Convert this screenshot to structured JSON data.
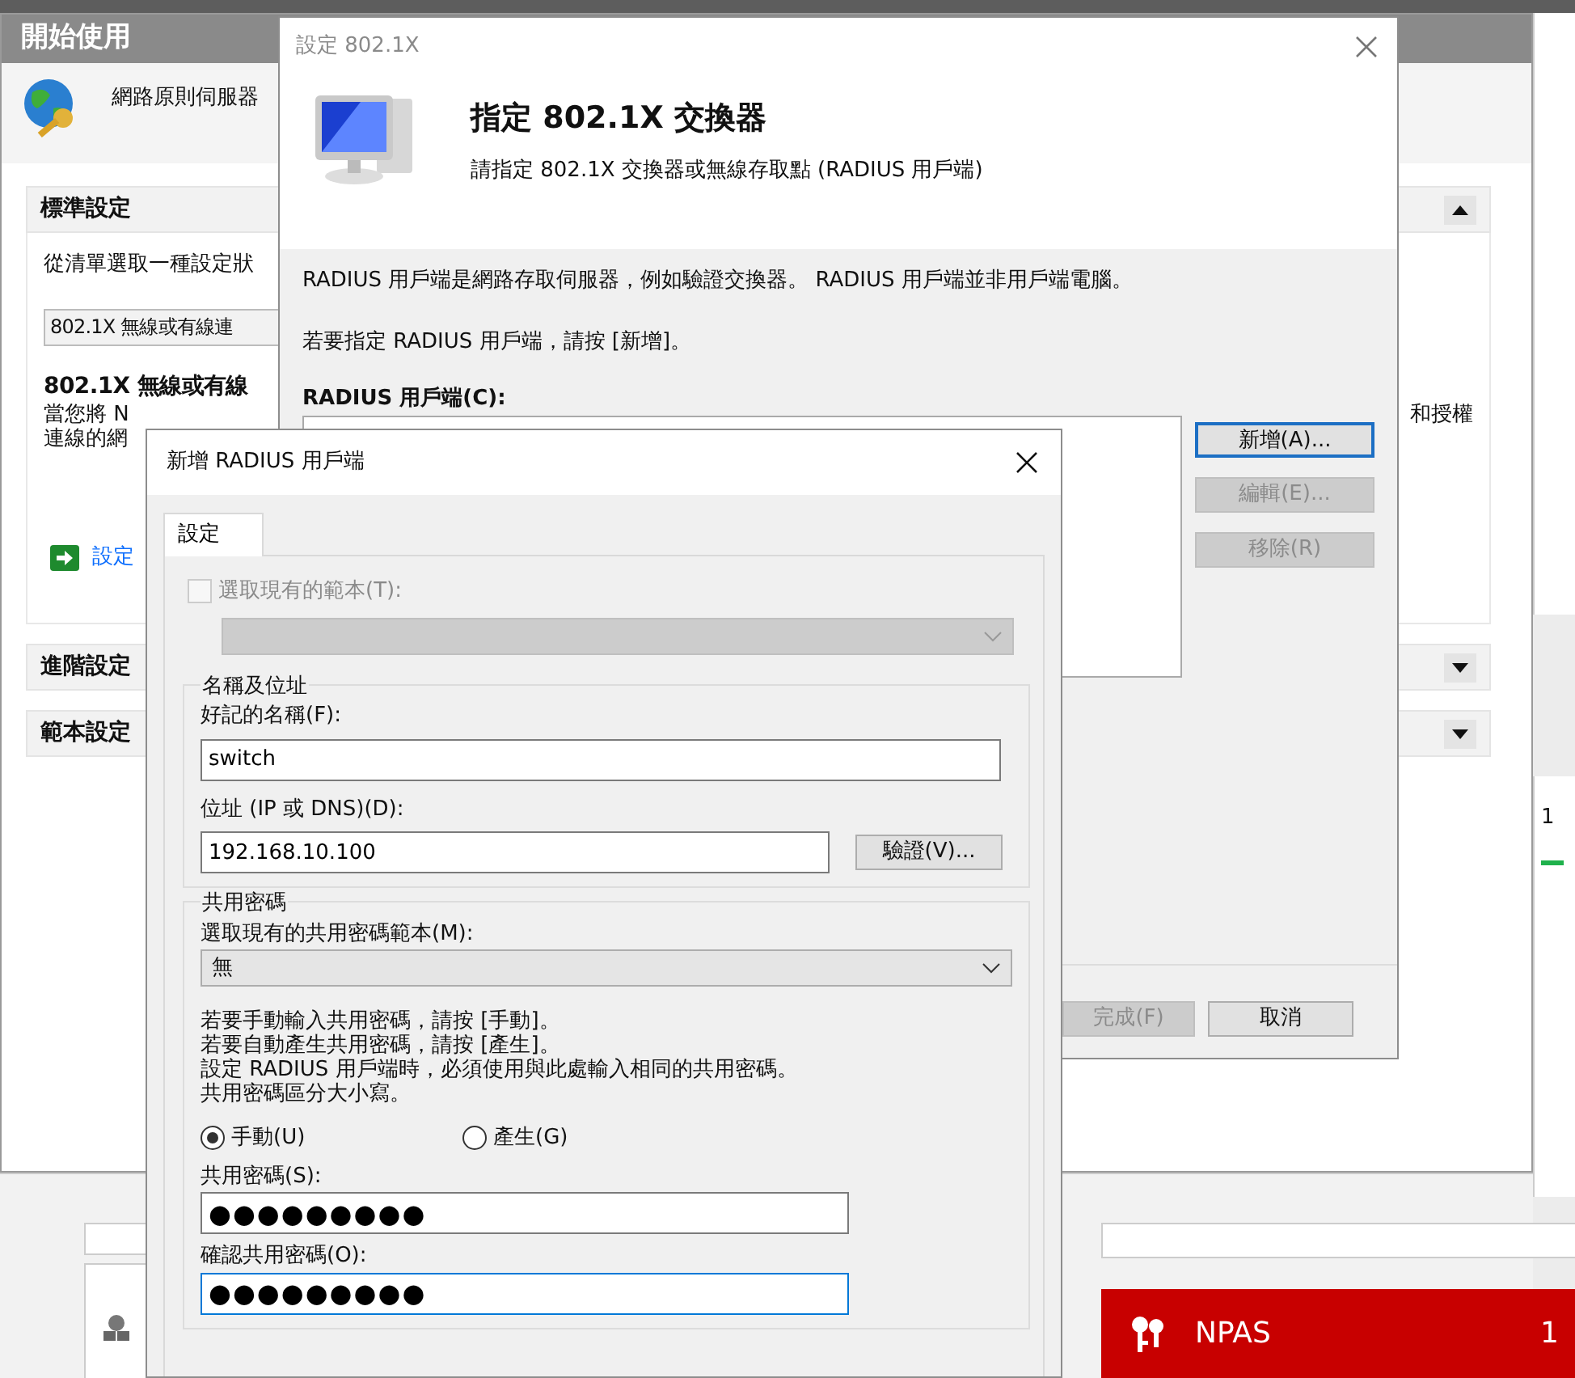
{
  "main_window": {
    "title": "開始使用",
    "server_name": "網路原則伺服器",
    "sections": [
      {
        "title": "標準設定",
        "expanded": true,
        "instruction": "從清單選取一種設定狀",
        "scenario": "802.1X 無線或有線連",
        "heading": "802.1X 無線或有線",
        "description_lines": [
          {
            "start": "當您將 N",
            "end": "和授權"
          },
          {
            "start": "連線的網"
          }
        ],
        "link": "設定"
      },
      {
        "title": "進階設定",
        "expanded": false
      },
      {
        "title": "範本設定",
        "expanded": false
      }
    ]
  },
  "side_panel": {
    "count": "1"
  },
  "npas_tile": {
    "title": "NPAS",
    "count": "1"
  },
  "wizard": {
    "title": "設定 802.1X",
    "heading": "指定 802.1X 交換器",
    "subheading": "請指定 802.1X 交換器或無線存取點 (RADIUS 用戶端)",
    "paragraphs": [
      "RADIUS 用戶端是網路存取伺服器，例如驗證交換器。 RADIUS 用戶端並非用戶端電腦。",
      "若要指定 RADIUS 用戶端，請按 [新增]。"
    ],
    "list_label": "RADIUS 用戶端(C):",
    "side_buttons": [
      {
        "label": "新增(A)...",
        "disabled": false,
        "focused": true
      },
      {
        "label": "編輯(E)...",
        "disabled": true,
        "focused": false
      },
      {
        "label": "移除(R)",
        "disabled": true,
        "focused": false
      }
    ],
    "footer_buttons": [
      {
        "label": "完成(F)",
        "disabled": true
      },
      {
        "label": "取消",
        "disabled": false
      }
    ]
  },
  "dialog": {
    "title": "新增 RADIUS 用戶端",
    "tabs": [
      {
        "label": "設定",
        "selected": true
      }
    ],
    "template": {
      "label": "選取現有的範本(T):",
      "checked": false,
      "disabled": true
    },
    "name_group": {
      "legend": "名稱及位址",
      "friendly_name_label": "好記的名稱(F):",
      "friendly_name": "switch",
      "address_label": "位址 (IP 或 DNS)(D):",
      "address": "192.168.10.100",
      "verify_button": "驗證(V)..."
    },
    "secret_group": {
      "legend": "共用密碼",
      "template_label": "選取現有的共用密碼範本(M):",
      "template_value": "無",
      "help_lines": [
        "若要手動輸入共用密碼，請按 [手動]。",
        "若要自動產生共用密碼，請按 [產生]。",
        "設定 RADIUS 用戶端時，必須使用與此處輸入相同的共用密碼。",
        "共用密碼區分大小寫。"
      ],
      "modes": [
        {
          "label": "手動(U)",
          "selected": true
        },
        {
          "label": "產生(G)",
          "selected": false
        }
      ],
      "secret_label": "共用密碼(S):",
      "secret": "●●●●●●●●●",
      "confirm_label": "確認共用密碼(O):",
      "confirm": "●●●●●●●●●",
      "confirm_focused": true
    }
  }
}
